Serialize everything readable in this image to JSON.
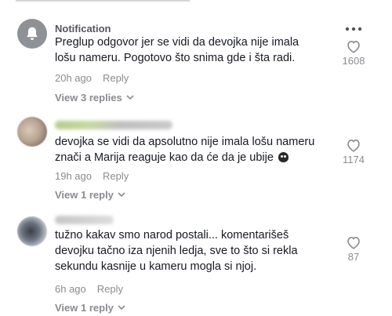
{
  "comments": [
    {
      "username": "Notification",
      "text": "Preglup odgovor jer se vidi da devojka nije imala lošu nameru. Pogotovo što snima gde i šta radi.",
      "time": "20h ago",
      "reply_label": "Reply",
      "view_replies": "View 3 replies",
      "likes": "1608",
      "avatar_icon": "bell-icon",
      "has_more_menu": true
    },
    {
      "username": "",
      "text": "devojka se vidi da apsolutno nije imala lošu nameru znači a Marija reaguje kao da će da je ubije",
      "emoji": "skull-emoji",
      "time": "19h ago",
      "reply_label": "Reply",
      "view_replies": "View 1 reply",
      "likes": "1174",
      "avatar_icon": "blurred-avatar"
    },
    {
      "username": "",
      "text": "tužno kakav smo narod postali... komentarišeš devojku tačno iza njenih ledja, sve to što si rekla sekundu kasnije u kameru mogla si njoj.",
      "time": "6h ago",
      "reply_label": "Reply",
      "view_replies": "View 1 reply",
      "likes": "87",
      "avatar_icon": "blurred-avatar"
    }
  ],
  "colors": {
    "text": "#161823",
    "secondary": "#8a8b91",
    "username": "#54565c"
  }
}
